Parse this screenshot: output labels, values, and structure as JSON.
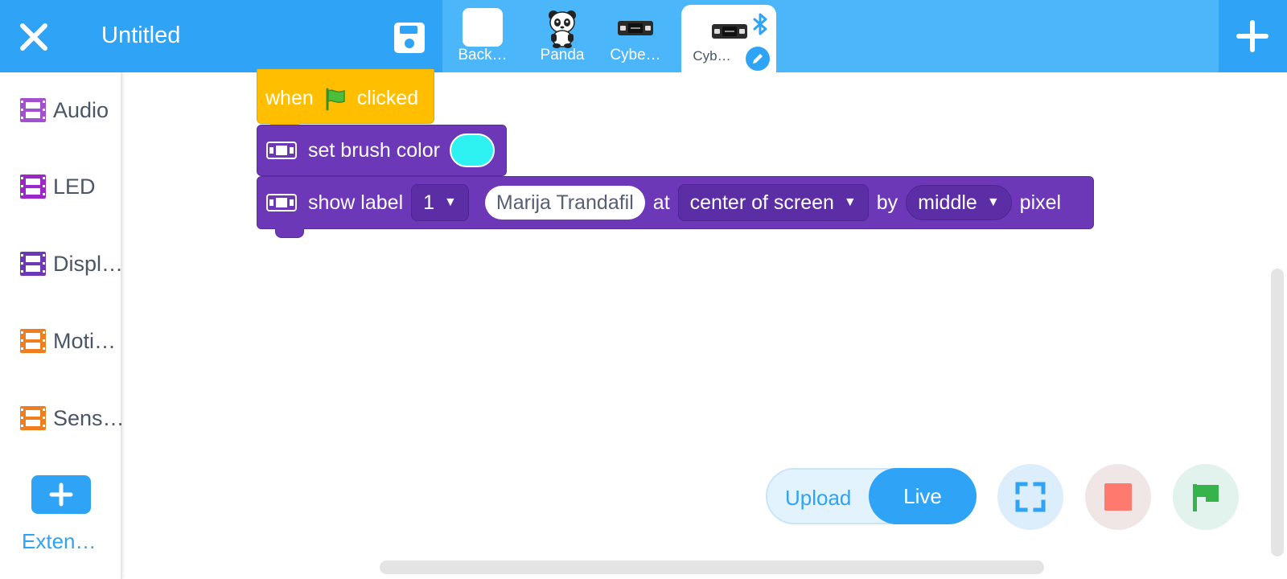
{
  "header": {
    "title": "Untitled"
  },
  "sprites": [
    {
      "label": "Back…",
      "kind": "backdrop"
    },
    {
      "label": "Panda",
      "kind": "panda"
    },
    {
      "label": "Cybe…",
      "kind": "cyberpi"
    },
    {
      "label": "Cyb…",
      "kind": "cyberpi",
      "active": true
    }
  ],
  "categories": [
    {
      "label": "Audio",
      "color": "#a24fd0"
    },
    {
      "label": "LED",
      "color": "#9c27c9"
    },
    {
      "label": "Displ…",
      "color": "#6c38b8"
    },
    {
      "label": "Moti…",
      "color": "#f07d1e"
    },
    {
      "label": "Sens…",
      "color": "#f07d1e"
    }
  ],
  "extensions": {
    "label": "Exten…"
  },
  "script": {
    "hat": {
      "when": "when",
      "clicked": "clicked"
    },
    "set_brush": {
      "text": "set brush color",
      "color": "#2ef2f2"
    },
    "show_label": {
      "text": "show label",
      "label_index": "1",
      "value": "Marija Trandafil",
      "at": "at",
      "position": "center of screen",
      "by": "by",
      "size": "middle",
      "pixel": "pixel"
    }
  },
  "controls": {
    "upload": "Upload",
    "live": "Live",
    "selected_mode": "Live"
  },
  "colors": {
    "accent": "#2fa3f5",
    "hat_block": "#ffbf00",
    "cyberpi_block": "#6c38b8"
  }
}
